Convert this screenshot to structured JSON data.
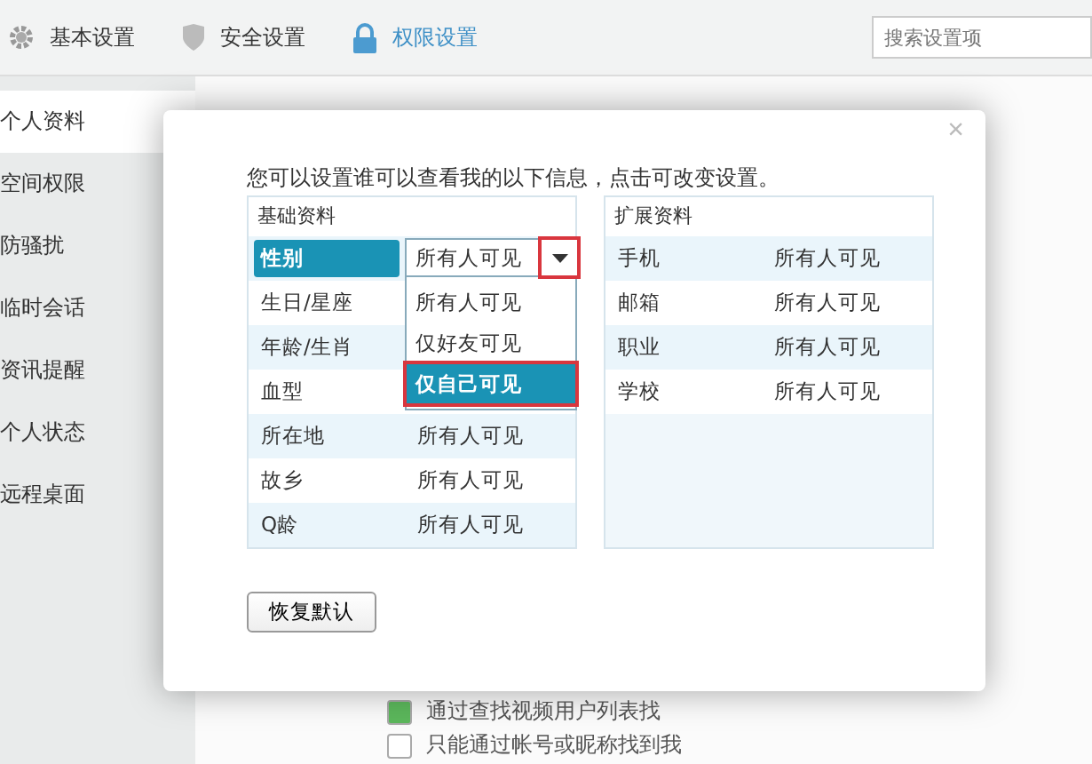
{
  "top_tabs": [
    {
      "label": "基本设置",
      "selected": false
    },
    {
      "label": "安全设置",
      "selected": false
    },
    {
      "label": "权限设置",
      "selected": true
    }
  ],
  "search": {
    "placeholder": "搜索设置项"
  },
  "sidebar": {
    "items": [
      {
        "label": "个人资料",
        "selected": true
      },
      {
        "label": "空间权限",
        "selected": false
      },
      {
        "label": "防骚扰",
        "selected": false
      },
      {
        "label": "临时会话",
        "selected": false
      },
      {
        "label": "资讯提醒",
        "selected": false
      },
      {
        "label": "个人状态",
        "selected": false
      },
      {
        "label": "远程桌面",
        "selected": false
      }
    ]
  },
  "background_options": [
    {
      "label": "通过查找视频用户列表找",
      "checked": true
    },
    {
      "label": "只能通过帐号或昵称找到我",
      "checked": false
    }
  ],
  "dialog": {
    "close": "×",
    "instruction": "您可以设置谁可以查看我的以下信息，点击可改变设置。",
    "basic": {
      "title": "基础资料",
      "rows": [
        {
          "label": "性别",
          "selected": true
        },
        {
          "label": "生日/星座",
          "selected": false
        },
        {
          "label": "年龄/生肖",
          "selected": false
        },
        {
          "label": "血型",
          "selected": false
        },
        {
          "label": "所在地",
          "value": "所有人可见",
          "selected": false
        },
        {
          "label": "故乡",
          "value": "所有人可见",
          "selected": false
        },
        {
          "label": "Q龄",
          "value": "所有人可见",
          "selected": false
        }
      ]
    },
    "dropdown": {
      "value": "所有人可见",
      "arrow_annotated": true,
      "options": [
        {
          "label": "所有人可见",
          "highlighted": false,
          "annotated": false
        },
        {
          "label": "仅好友可见",
          "highlighted": false,
          "annotated": false
        },
        {
          "label": "仅自己可见",
          "highlighted": true,
          "annotated": true
        }
      ]
    },
    "extended": {
      "title": "扩展资料",
      "rows": [
        {
          "label": "手机",
          "value": "所有人可见"
        },
        {
          "label": "邮箱",
          "value": "所有人可见"
        },
        {
          "label": "职业",
          "value": "所有人可见"
        },
        {
          "label": "学校",
          "value": "所有人可见"
        }
      ]
    },
    "restore_button": "恢复默认"
  }
}
